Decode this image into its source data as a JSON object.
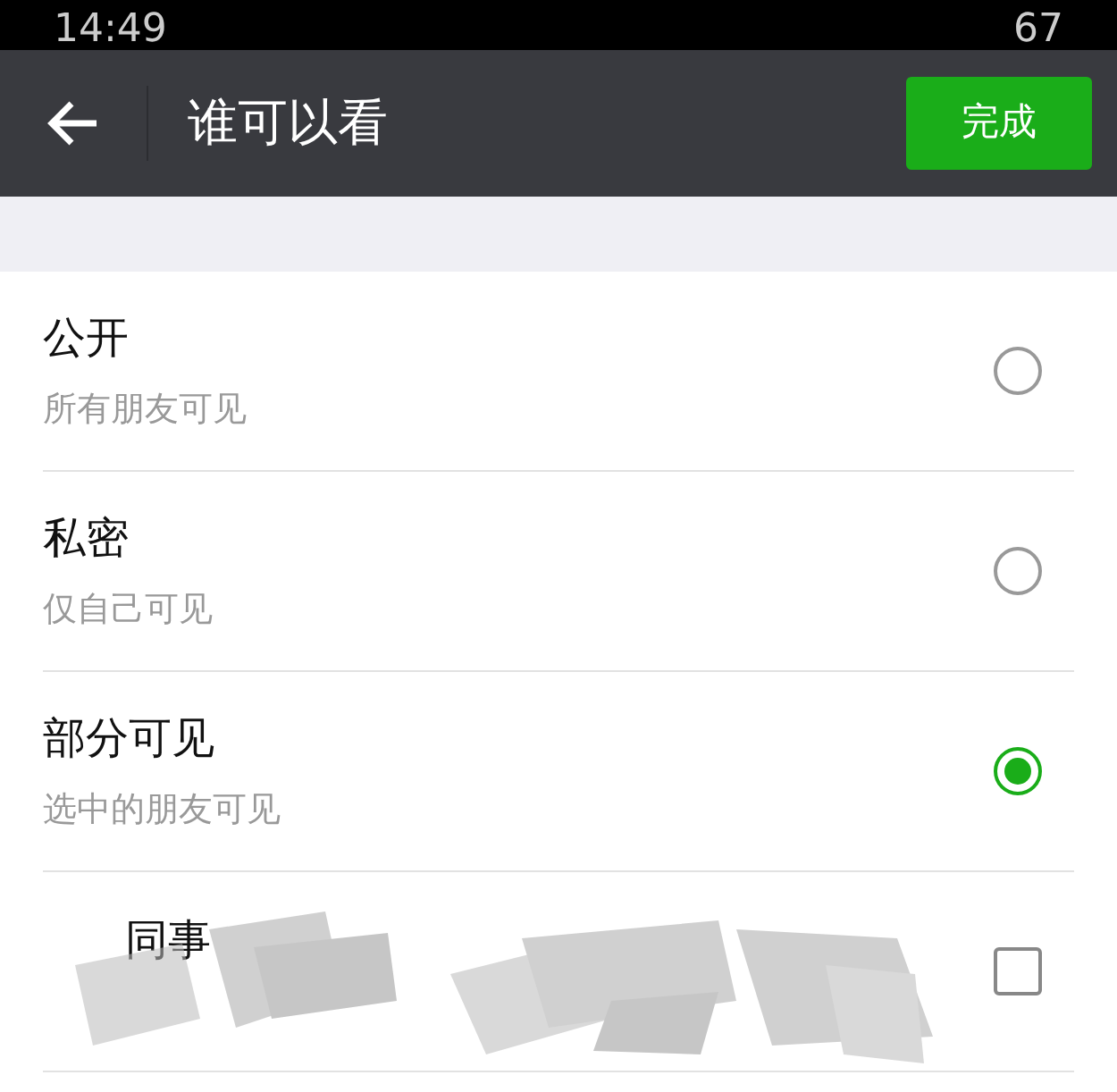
{
  "status_bar": {
    "time": "14:49",
    "battery": "67"
  },
  "header": {
    "title": "谁可以看",
    "done_button": "完成"
  },
  "options": [
    {
      "title": "公开",
      "subtitle": "所有朋友可见",
      "selected": false
    },
    {
      "title": "私密",
      "subtitle": "仅自己可见",
      "selected": false
    },
    {
      "title": "部分可见",
      "subtitle": "选中的朋友可见",
      "selected": true
    }
  ],
  "groups": [
    {
      "name": "同事",
      "checked": false
    }
  ]
}
